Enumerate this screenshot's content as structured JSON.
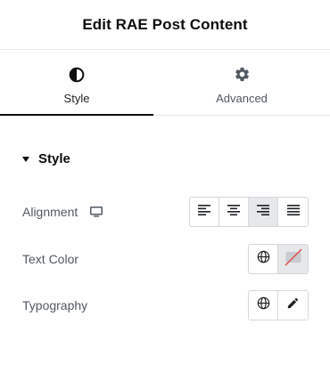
{
  "header": {
    "title": "Edit RAE Post Content"
  },
  "tabs": [
    {
      "label": "Style",
      "icon": "half-circle-icon",
      "active": true
    },
    {
      "label": "Advanced",
      "icon": "gear-icon",
      "active": false
    }
  ],
  "section": {
    "title": "Style",
    "expanded": true
  },
  "controls": {
    "alignment": {
      "label": "Alignment",
      "options": [
        "left",
        "center",
        "right",
        "justify"
      ],
      "selected": "right"
    },
    "text_color": {
      "label": "Text Color",
      "value": "none"
    },
    "typography": {
      "label": "Typography"
    }
  },
  "colors": {
    "title": "#0c0d0e",
    "label": "#515962",
    "border": "#d5d8dc",
    "active_bg": "#e6e8ea",
    "swatch_slash": "#e34b4b"
  }
}
